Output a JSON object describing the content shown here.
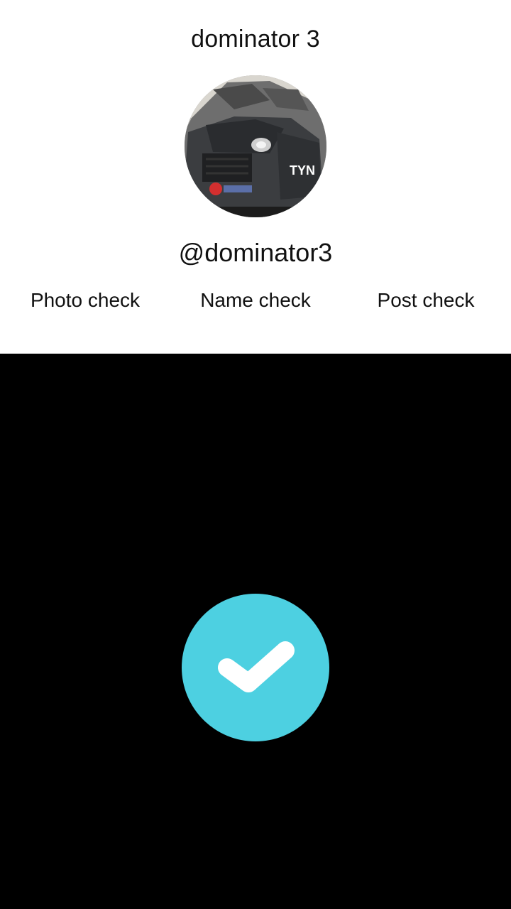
{
  "profile": {
    "display_name": "dominator 3",
    "username": "@dominator3",
    "avatar_text": "TYN"
  },
  "checks": {
    "photo_label": "Photo check",
    "name_label": "Name check",
    "post_label": "Post check"
  },
  "badge": {
    "icon": "checkmark-icon",
    "color": "#4dd0e1"
  },
  "colors": {
    "top_background": "#ffffff",
    "bottom_background": "#000000",
    "text": "#111111"
  }
}
